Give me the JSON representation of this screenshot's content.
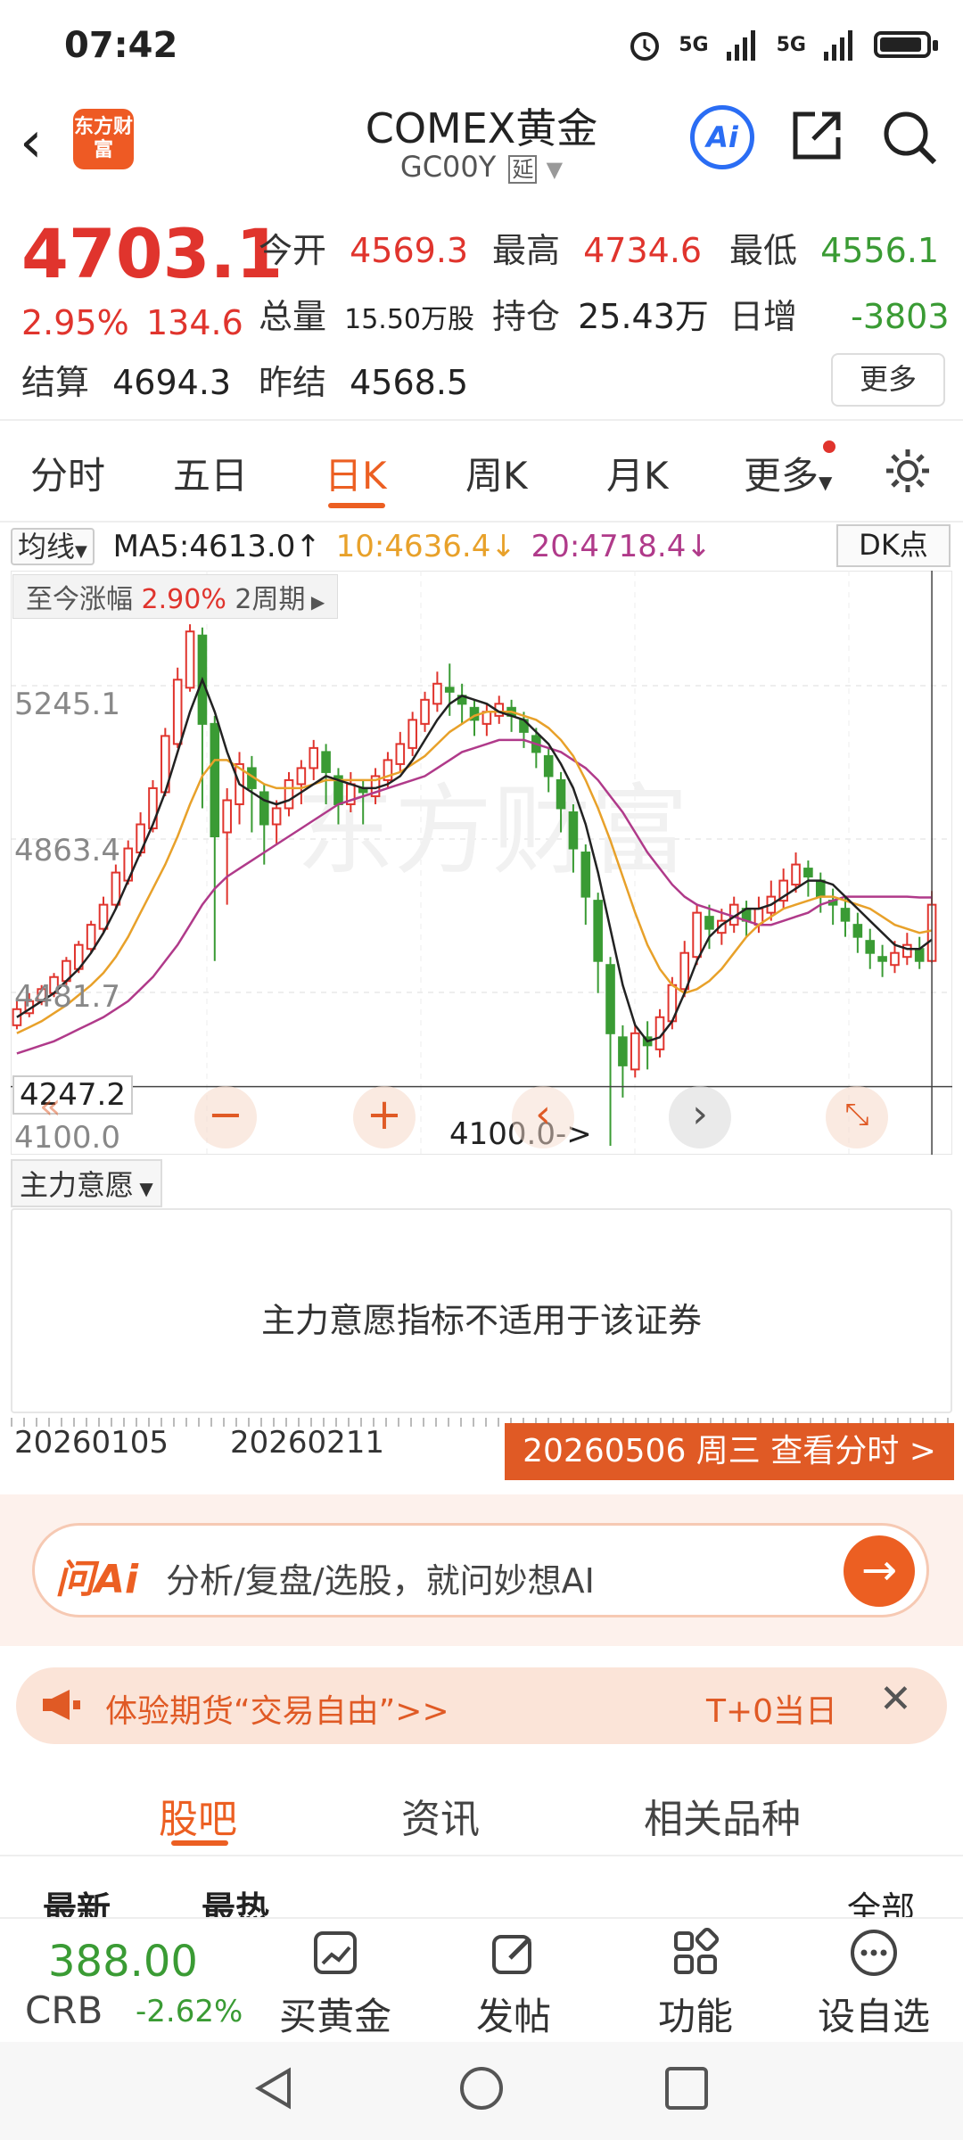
{
  "status": {
    "time": "07:42",
    "sig1": "5G",
    "sig2": "5G"
  },
  "header": {
    "brand": "东方财富",
    "title": "COMEX黄金",
    "code": "GC00Y",
    "delay_tag": "延"
  },
  "quote": {
    "price": "4703.1",
    "chg_pct": "2.95%",
    "chg": "134.6",
    "open_label": "今开",
    "open": "4569.3",
    "high_label": "最高",
    "high": "4734.6",
    "low_label": "最低",
    "low": "4556.1",
    "vol_label": "总量",
    "vol": "15.50万股",
    "oi_label": "持仓",
    "oi": "25.43万",
    "dinc_label": "日增",
    "dinc": "-3803",
    "settle_label": "结算",
    "settle": "4694.3",
    "prev_label": "昨结",
    "prev": "4568.5",
    "more": "更多"
  },
  "tabs": [
    "分时",
    "五日",
    "日K",
    "周K",
    "月K",
    "更多"
  ],
  "ma": {
    "dropdown": "均线",
    "ma5": "MA5:4613.0",
    "ma10": "10:4636.4",
    "ma20": "20:4718.4",
    "dk": "DK点",
    "colors": {
      "ma5": "#222222",
      "ma10": "#e8a12a",
      "ma20": "#b03a8a",
      "up": "#e0342d",
      "down": "#3a9b34"
    }
  },
  "gain_tag": {
    "label": "至今涨幅",
    "value": "2.90%",
    "period": "2周期"
  },
  "chart_axis": {
    "y1": "5245.1",
    "y2": "4863.4",
    "y3": "4481.7",
    "crosshair": "4247.2",
    "bottom": "4100.0",
    "low_marker": "4100.0->"
  },
  "chart_data": {
    "type": "candlestick",
    "x_start": "20260105",
    "x_mid": "20260211",
    "ylim": [
      4100.0,
      5398.2
    ],
    "candles": [
      [
        4400,
        4440,
        4390,
        4460
      ],
      [
        4430,
        4460,
        4420,
        4480
      ],
      [
        4460,
        4490,
        4450,
        4500
      ],
      [
        4480,
        4520,
        4470,
        4530
      ],
      [
        4510,
        4560,
        4500,
        4570
      ],
      [
        4540,
        4600,
        4530,
        4610
      ],
      [
        4590,
        4650,
        4580,
        4660
      ],
      [
        4640,
        4700,
        4630,
        4720
      ],
      [
        4700,
        4780,
        4690,
        4800
      ],
      [
        4760,
        4840,
        4750,
        4860
      ],
      [
        4830,
        4900,
        4820,
        4930
      ],
      [
        4890,
        4990,
        4880,
        5010
      ],
      [
        4980,
        5120,
        4970,
        5140
      ],
      [
        5100,
        5260,
        5090,
        5290
      ],
      [
        5240,
        5380,
        5230,
        5398
      ],
      [
        5370,
        5150,
        4940,
        5390
      ],
      [
        5150,
        4870,
        4560,
        5170
      ],
      [
        4880,
        4960,
        4700,
        4990
      ],
      [
        4950,
        5050,
        4900,
        5080
      ],
      [
        5040,
        4990,
        4880,
        5070
      ],
      [
        4980,
        4900,
        4800,
        5000
      ],
      [
        4900,
        4940,
        4850,
        4960
      ],
      [
        4940,
        5010,
        4920,
        5030
      ],
      [
        5000,
        5040,
        4950,
        5060
      ],
      [
        5040,
        5090,
        5010,
        5110
      ],
      [
        5080,
        5030,
        4950,
        5100
      ],
      [
        5020,
        4950,
        4900,
        5040
      ],
      [
        4950,
        5000,
        4930,
        5030
      ],
      [
        4990,
        4980,
        4900,
        5010
      ],
      [
        4970,
        5020,
        4950,
        5040
      ],
      [
        5010,
        5060,
        4990,
        5080
      ],
      [
        5050,
        5100,
        5030,
        5130
      ],
      [
        5090,
        5160,
        5070,
        5180
      ],
      [
        5150,
        5210,
        5130,
        5230
      ],
      [
        5200,
        5250,
        5180,
        5280
      ],
      [
        5240,
        5230,
        5170,
        5300
      ],
      [
        5220,
        5200,
        5150,
        5250
      ],
      [
        5190,
        5160,
        5120,
        5210
      ],
      [
        5150,
        5180,
        5120,
        5200
      ],
      [
        5170,
        5200,
        5150,
        5220
      ],
      [
        5190,
        5170,
        5130,
        5210
      ],
      [
        5160,
        5130,
        5090,
        5180
      ],
      [
        5120,
        5080,
        5040,
        5140
      ],
      [
        5070,
        5020,
        4980,
        5090
      ],
      [
        5010,
        4940,
        4880,
        5030
      ],
      [
        4930,
        4840,
        4780,
        4950
      ],
      [
        4830,
        4720,
        4650,
        4850
      ],
      [
        4710,
        4560,
        4480,
        4730
      ],
      [
        4550,
        4380,
        4100,
        4570
      ],
      [
        4370,
        4300,
        4220,
        4400
      ],
      [
        4290,
        4380,
        4270,
        4400
      ],
      [
        4370,
        4350,
        4290,
        4410
      ],
      [
        4340,
        4420,
        4320,
        4440
      ],
      [
        4410,
        4500,
        4390,
        4520
      ],
      [
        4490,
        4580,
        4470,
        4610
      ],
      [
        4570,
        4680,
        4550,
        4700
      ],
      [
        4670,
        4640,
        4590,
        4700
      ],
      [
        4630,
        4660,
        4600,
        4690
      ],
      [
        4650,
        4700,
        4630,
        4720
      ],
      [
        4690,
        4660,
        4620,
        4710
      ],
      [
        4650,
        4690,
        4630,
        4720
      ],
      [
        4680,
        4720,
        4660,
        4760
      ],
      [
        4710,
        4760,
        4690,
        4790
      ],
      [
        4750,
        4800,
        4730,
        4830
      ],
      [
        4790,
        4770,
        4720,
        4810
      ],
      [
        4760,
        4720,
        4680,
        4780
      ],
      [
        4710,
        4700,
        4650,
        4740
      ],
      [
        4690,
        4660,
        4620,
        4720
      ],
      [
        4650,
        4620,
        4580,
        4680
      ],
      [
        4610,
        4580,
        4540,
        4640
      ],
      [
        4570,
        4560,
        4520,
        4600
      ],
      [
        4550,
        4580,
        4530,
        4610
      ],
      [
        4570,
        4600,
        4550,
        4630
      ],
      [
        4590,
        4560,
        4540,
        4620
      ],
      [
        4560,
        4700,
        4556,
        4734
      ]
    ],
    "ma5": [
      4420,
      4440,
      4460,
      4480,
      4510,
      4540,
      4580,
      4630,
      4690,
      4760,
      4830,
      4900,
      4980,
      5080,
      5180,
      5260,
      5180,
      5080,
      5000,
      4980,
      4960,
      4950,
      4960,
      4980,
      5000,
      5020,
      5010,
      5000,
      4990,
      4990,
      5000,
      5020,
      5060,
      5110,
      5160,
      5200,
      5220,
      5210,
      5200,
      5180,
      5170,
      5160,
      5130,
      5100,
      5050,
      4990,
      4900,
      4780,
      4640,
      4500,
      4400,
      4360,
      4370,
      4410,
      4480,
      4560,
      4620,
      4650,
      4670,
      4690,
      4690,
      4700,
      4720,
      4740,
      4760,
      4760,
      4750,
      4720,
      4690,
      4660,
      4630,
      4600,
      4590,
      4590,
      4613
    ],
    "ma10": [
      4380,
      4395,
      4410,
      4430,
      4450,
      4475,
      4500,
      4530,
      4570,
      4620,
      4680,
      4740,
      4800,
      4870,
      4950,
      5020,
      5060,
      5060,
      5040,
      5020,
      5000,
      4990,
      4990,
      4990,
      5000,
      5010,
      5010,
      5010,
      5010,
      5010,
      5020,
      5030,
      5050,
      5070,
      5100,
      5130,
      5150,
      5170,
      5180,
      5180,
      5180,
      5170,
      5160,
      5140,
      5110,
      5070,
      5010,
      4940,
      4860,
      4770,
      4680,
      4600,
      4540,
      4500,
      4480,
      4490,
      4510,
      4540,
      4580,
      4620,
      4650,
      4670,
      4690,
      4700,
      4710,
      4720,
      4720,
      4710,
      4700,
      4690,
      4670,
      4650,
      4640,
      4630,
      4636
    ],
    "ma20": [
      4330,
      4340,
      4350,
      4360,
      4375,
      4390,
      4405,
      4420,
      4440,
      4460,
      4490,
      4520,
      4560,
      4600,
      4650,
      4700,
      4740,
      4770,
      4790,
      4810,
      4830,
      4850,
      4870,
      4890,
      4910,
      4930,
      4950,
      4960,
      4970,
      4980,
      4990,
      5000,
      5010,
      5020,
      5040,
      5060,
      5080,
      5090,
      5100,
      5110,
      5110,
      5110,
      5100,
      5090,
      5080,
      5060,
      5040,
      5010,
      4970,
      4930,
      4880,
      4830,
      4790,
      4750,
      4720,
      4700,
      4690,
      4680,
      4670,
      4660,
      4650,
      4650,
      4660,
      4670,
      4680,
      4700,
      4710,
      4720,
      4720,
      4720,
      4720,
      4720,
      4720,
      4718,
      4718
    ]
  },
  "zl": {
    "dropdown": "主力意愿",
    "message": "主力意愿指标不适用于该证券"
  },
  "dates": {
    "d1": "20260105",
    "d2": "20260211",
    "button": "20260506 周三 查看分时 >"
  },
  "ai": {
    "logo": "问Ai",
    "placeholder": "分析/复盘/选股，就问妙想AI"
  },
  "promo": {
    "text": "体验期货“交易自由”>>",
    "right": "T+0当日"
  },
  "guba_tabs": [
    "股吧",
    "资讯",
    "相关品种"
  ],
  "sub_tabs": {
    "latest": "最新",
    "hot": "最热",
    "filter": "全部"
  },
  "bottom": {
    "crb_value": "388.00",
    "crb_name": "CRB",
    "crb_chg": "-2.62%",
    "items": [
      "买黄金",
      "发帖",
      "功能",
      "设自选"
    ]
  }
}
